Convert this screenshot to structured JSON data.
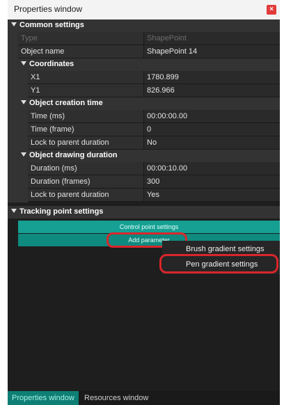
{
  "window": {
    "title": "Properties window",
    "close_glyph": "×"
  },
  "sections": {
    "common": "Common settings",
    "coordinates": "Coordinates",
    "creation_time": "Object creation time",
    "drawing_duration": "Object drawing duration",
    "tracking": "Tracking point settings"
  },
  "rows": {
    "type": {
      "name": "Type",
      "value": "ShapePoint"
    },
    "object_name": {
      "name": "Object name",
      "value": "ShapePoint 14"
    },
    "x1": {
      "name": "X1",
      "value": "1780.899"
    },
    "y1": {
      "name": "Y1",
      "value": "826.966"
    },
    "time_ms": {
      "name": "Time (ms)",
      "value": "00:00:00.00"
    },
    "time_frame": {
      "name": "Time (frame)",
      "value": "0"
    },
    "lock_creation": {
      "name": "Lock to parent duration",
      "value": "No"
    },
    "duration_ms": {
      "name": "Duration (ms)",
      "value": "00:00:10.00"
    },
    "duration_frames": {
      "name": "Duration (frames)",
      "value": "300"
    },
    "lock_drawing": {
      "name": "Lock to parent duration",
      "value": "Yes"
    }
  },
  "tracking": {
    "control_point_settings": "Control point settings",
    "add_parameter": "Add parameter"
  },
  "menu": {
    "brush_gradient": "Brush gradient settings",
    "pen_gradient": "Pen gradient settings"
  },
  "tabs": {
    "properties": "Properties window",
    "resources": "Resources window"
  },
  "colors": {
    "accent": "#15a093",
    "highlight_outline": "#d9262b",
    "close_button": "#e23b3b"
  }
}
